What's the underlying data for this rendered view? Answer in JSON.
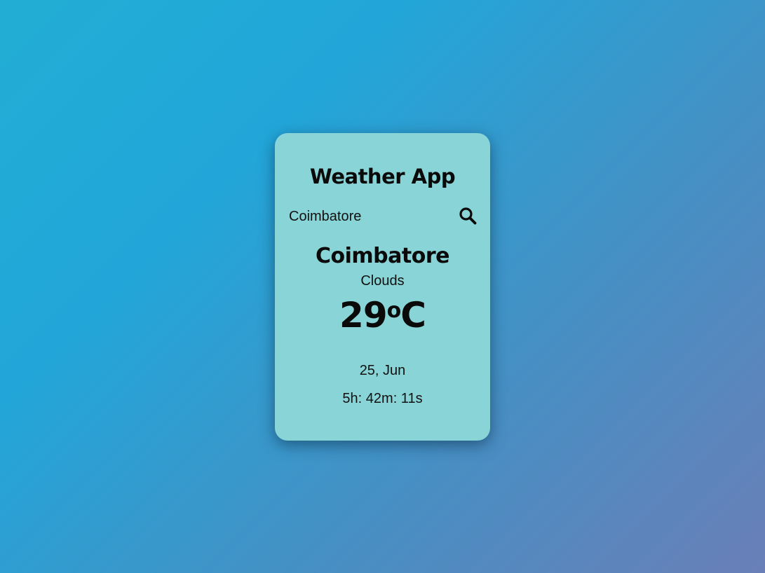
{
  "app": {
    "title": "Weather App"
  },
  "search": {
    "value": "Coimbatore",
    "placeholder": "Coimbatore",
    "icon": "search-icon"
  },
  "weather": {
    "city": "Coimbatore",
    "condition": "Clouds",
    "temperature": "29",
    "degree_symbol": "o",
    "unit": "C",
    "date": "25, Jun",
    "time": "5h: 42m: 11s"
  },
  "colors": {
    "card_background": "#89d4d6",
    "gradient_start": "#22aed4",
    "gradient_end": "#6a7fb8",
    "text": "#0a0a0a"
  }
}
